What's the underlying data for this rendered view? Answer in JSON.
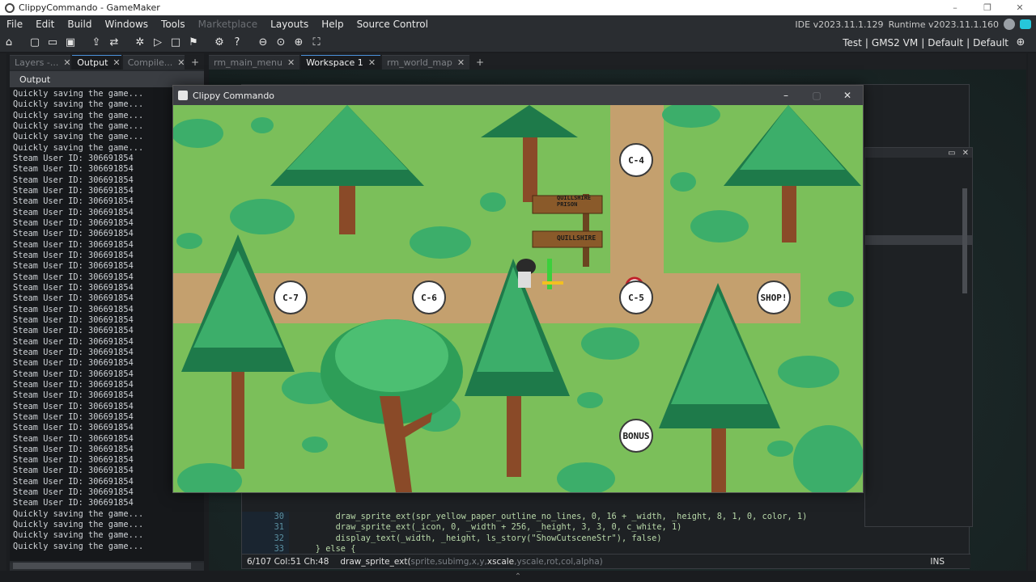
{
  "window": {
    "title": "ClippyCommando - GameMaker"
  },
  "menu": {
    "items": [
      "File",
      "Edit",
      "Build",
      "Windows",
      "Tools",
      "Marketplace",
      "Layouts",
      "Help",
      "Source Control"
    ],
    "ide_version": "IDE v2023.11.1.129",
    "runtime_version": "Runtime v2023.11.1.160"
  },
  "toolbar": {
    "target": "Test",
    "vm": "GMS2 VM",
    "config1": "Default",
    "config2": "Default"
  },
  "left_panel": {
    "tabs": [
      "Layers -...",
      "Output",
      "Compile..."
    ],
    "header": "Output",
    "lines": [
      "Quickly saving the game...",
      "Quickly saving the game...",
      "Quickly saving the game...",
      "Quickly saving the game...",
      "Quickly saving the game...",
      "Quickly saving the game...",
      "Steam User ID: 306691854",
      "Steam User ID: 306691854",
      "Steam User ID: 306691854",
      "Steam User ID: 306691854",
      "Steam User ID: 306691854",
      "Steam User ID: 306691854",
      "Steam User ID: 306691854",
      "Steam User ID: 306691854",
      "Steam User ID: 306691854",
      "Steam User ID: 306691854",
      "Steam User ID: 306691854",
      "Steam User ID: 306691854",
      "Steam User ID: 306691854",
      "Steam User ID: 306691854",
      "Steam User ID: 306691854",
      "Steam User ID: 306691854",
      "Steam User ID: 306691854",
      "Steam User ID: 306691854",
      "Steam User ID: 306691854",
      "Steam User ID: 306691854",
      "Steam User ID: 306691854",
      "Steam User ID: 306691854",
      "Steam User ID: 306691854",
      "Steam User ID: 306691854",
      "Steam User ID: 306691854",
      "Steam User ID: 306691854",
      "Steam User ID: 306691854",
      "Steam User ID: 306691854",
      "Steam User ID: 306691854",
      "Steam User ID: 306691854",
      "Steam User ID: 306691854",
      "Steam User ID: 306691854",
      "Steam User ID: 306691854",
      "Quickly saving the game...",
      "Quickly saving the game...",
      "Quickly saving the game...",
      "Quickly saving the game..."
    ]
  },
  "workspace": {
    "tabs": [
      "rm_main_menu",
      "Workspace 1",
      "rm_world_map"
    ],
    "active_tab": 1,
    "code_lines": [
      {
        "n": "30",
        "text": "        draw_sprite_ext(spr_yellow_paper_outline_no_lines, 0, 16 + _width, _height, 8, 1, 0, color, 1)"
      },
      {
        "n": "31",
        "text": "        draw_sprite_ext(_icon, 0, _width + 256, _height, 3, 3, 0, c_white, 1)"
      },
      {
        "n": "32",
        "text": "        display_text(_width, _height, ls_story(\"ShowCutsceneStr\"), false)"
      },
      {
        "n": "33",
        "text": "    } else {"
      }
    ],
    "status": {
      "position": "6/107 Col:51 Ch:48",
      "signature_fn": "draw_sprite_ext(",
      "sig_a": "sprite,subimg,x,y,",
      "sig_b": "xscale",
      "sig_c": ",yscale,rot,col,alpha)",
      "mode": "INS"
    }
  },
  "game": {
    "title": "Clippy Commando",
    "levels": [
      {
        "label": "C-7"
      },
      {
        "label": "C-6"
      },
      {
        "label": "C-5"
      },
      {
        "label": "C-4"
      },
      {
        "label": "SHOP!"
      },
      {
        "label": "BONUS"
      }
    ],
    "signs": [
      "QUILLSHIRE PRISON",
      "QUILLSHIRE"
    ],
    "colors": {
      "grass": "#7bbf5a",
      "path": "#c8a070",
      "tree_dark": "#1e7a4a",
      "tree_light": "#3cae6a",
      "trunk": "#8a4a28"
    }
  }
}
